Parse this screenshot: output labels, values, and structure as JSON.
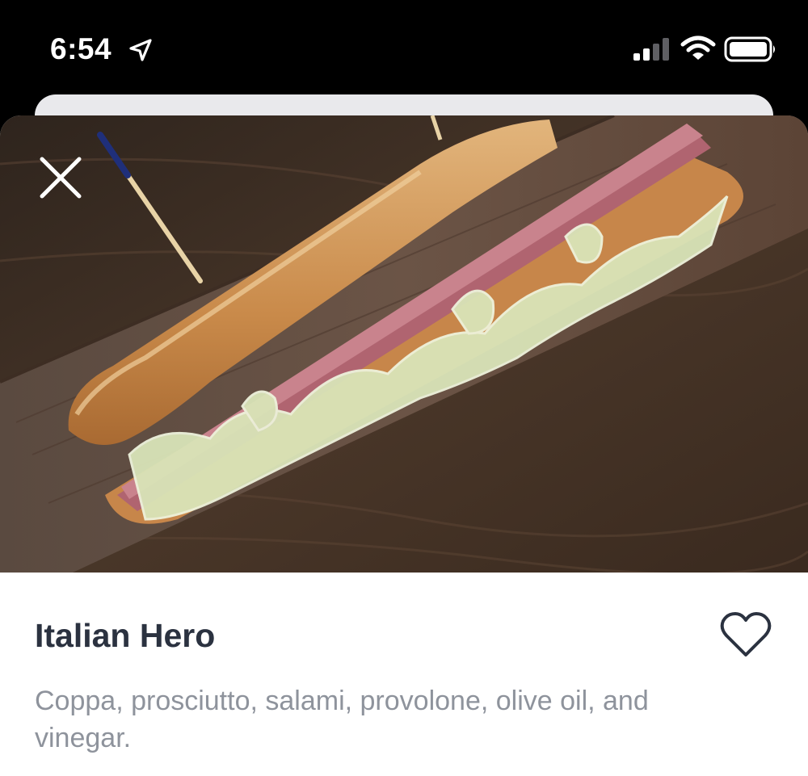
{
  "status_bar": {
    "time": "6:54",
    "icons": [
      "location-arrow-icon",
      "cellular-signal-icon",
      "wifi-icon",
      "battery-icon"
    ]
  },
  "item": {
    "title": "Italian Hero",
    "description": "Coppa, prosciutto, salami, provolone, olive oil, and vinegar.",
    "image": "sandwich-photo"
  },
  "controls": {
    "close": "close-icon",
    "favorite": "heart-icon"
  },
  "colors": {
    "title": "#2b3240",
    "description": "#8e939c",
    "background": "#ffffff"
  }
}
